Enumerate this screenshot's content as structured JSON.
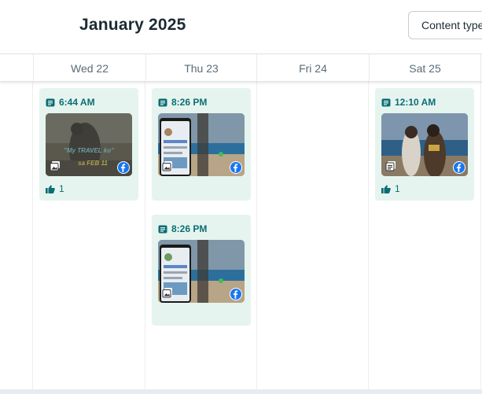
{
  "header": {
    "month_title": "January 2025",
    "content_type_label": "Content types"
  },
  "days": [
    {
      "label": "Wed 22"
    },
    {
      "label": "Thu 23"
    },
    {
      "label": "Fri 24"
    },
    {
      "label": "Sat 25"
    }
  ],
  "posts": [
    {
      "time": "6:44 AM",
      "likes": "1",
      "platform": "facebook-icon",
      "media_overlay": "My TRAVEL ko sa FEB 11",
      "media_type": "gallery"
    },
    {
      "time": "8:26 PM",
      "platform": "facebook-icon",
      "media_type": "gallery"
    },
    {
      "time": "8:26 PM",
      "platform": "facebook-icon",
      "media_type": "gallery"
    },
    {
      "time": "12:10 AM",
      "likes": "1",
      "platform": "facebook-icon",
      "media_type": "document"
    }
  ],
  "colors": {
    "card_bg": "#e6f4ef",
    "accent": "#0b6e74",
    "facebook": "#1877f2"
  }
}
